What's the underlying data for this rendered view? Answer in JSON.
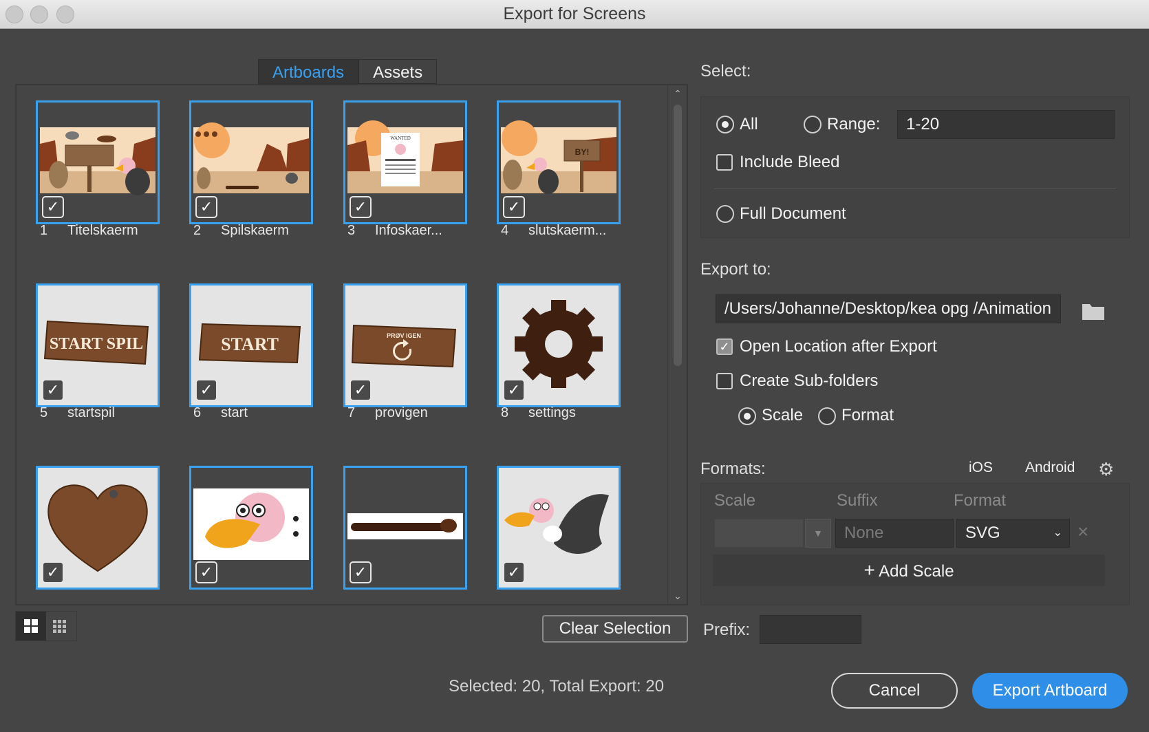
{
  "window": {
    "title": "Export for Screens"
  },
  "tabs": [
    {
      "label": "Artboards",
      "active": true
    },
    {
      "label": "Assets",
      "active": false
    }
  ],
  "artboards": [
    {
      "num": "1",
      "name": "Titelskaerm"
    },
    {
      "num": "2",
      "name": "Spilskaerm"
    },
    {
      "num": "3",
      "name": "Infoskaer..."
    },
    {
      "num": "4",
      "name": "slutskaerm..."
    },
    {
      "num": "5",
      "name": "startspil"
    },
    {
      "num": "6",
      "name": "start"
    },
    {
      "num": "7",
      "name": "provigen"
    },
    {
      "num": "8",
      "name": "settings"
    }
  ],
  "art_text": {
    "startspil": "START SPIL",
    "start": "START",
    "provigen": "PRØV IGEN",
    "wanted": "WANTED",
    "bye": "BY!"
  },
  "clear_selection": "Clear Selection",
  "status": "Selected: 20, Total Export: 20",
  "select": {
    "label": "Select:",
    "all": "All",
    "range": "Range:",
    "range_value": "1-20",
    "include_bleed": "Include Bleed",
    "full_document": "Full Document"
  },
  "export_to": {
    "label": "Export to:",
    "path": "/Users/Johanne/Desktop/kea opg /Animation",
    "open_location": "Open Location after Export",
    "sub_folders": "Create Sub-folders",
    "scale": "Scale",
    "format": "Format"
  },
  "formats": {
    "label": "Formats:",
    "ios": "iOS",
    "android": "Android",
    "col_scale": "Scale",
    "col_suffix": "Suffix",
    "col_format": "Format",
    "suffix_placeholder": "None",
    "format_value": "SVG",
    "add_scale": "Add Scale"
  },
  "prefix": {
    "label": "Prefix:"
  },
  "buttons": {
    "cancel": "Cancel",
    "export": "Export Artboard"
  },
  "colors": {
    "accent": "#3aa0f0",
    "export_button": "#2f8fe8",
    "wood": "#7a4a2a",
    "gear": "#3e1f10"
  }
}
